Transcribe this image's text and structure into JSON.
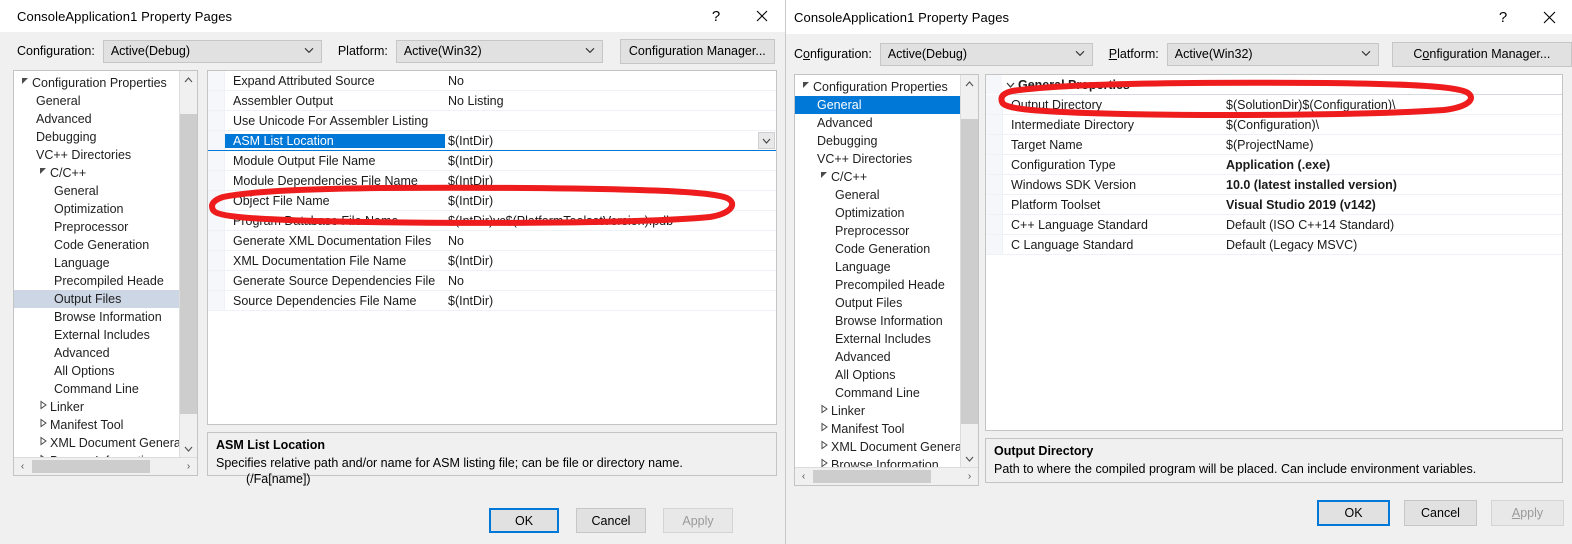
{
  "left_dialog": {
    "title": "ConsoleApplication1 Property Pages",
    "caption": {
      "help": "?",
      "close": "✕"
    },
    "config": {
      "configuration_label": "Configuration:",
      "configuration_value": "Active(Debug)",
      "platform_label": "Platform:",
      "platform_value": "Active(Win32)",
      "config_manager_button": "Configuration Manager..."
    },
    "tree": [
      {
        "label": "Configuration Properties",
        "indent": 0,
        "twisty": "expanded",
        "state": "normal"
      },
      {
        "label": "General",
        "indent": 1,
        "twisty": "none",
        "state": "normal"
      },
      {
        "label": "Advanced",
        "indent": 1,
        "twisty": "none",
        "state": "normal"
      },
      {
        "label": "Debugging",
        "indent": 1,
        "twisty": "none",
        "state": "normal"
      },
      {
        "label": "VC++ Directories",
        "indent": 1,
        "twisty": "none",
        "state": "normal"
      },
      {
        "label": "C/C++",
        "indent": 1,
        "twisty": "expanded",
        "state": "normal"
      },
      {
        "label": "General",
        "indent": 2,
        "twisty": "none",
        "state": "normal"
      },
      {
        "label": "Optimization",
        "indent": 2,
        "twisty": "none",
        "state": "normal"
      },
      {
        "label": "Preprocessor",
        "indent": 2,
        "twisty": "none",
        "state": "normal"
      },
      {
        "label": "Code Generation",
        "indent": 2,
        "twisty": "none",
        "state": "normal"
      },
      {
        "label": "Language",
        "indent": 2,
        "twisty": "none",
        "state": "normal"
      },
      {
        "label": "Precompiled Heade",
        "indent": 2,
        "twisty": "none",
        "state": "normal"
      },
      {
        "label": "Output Files",
        "indent": 2,
        "twisty": "none",
        "state": "selected"
      },
      {
        "label": "Browse Information",
        "indent": 2,
        "twisty": "none",
        "state": "normal"
      },
      {
        "label": "External Includes",
        "indent": 2,
        "twisty": "none",
        "state": "normal"
      },
      {
        "label": "Advanced",
        "indent": 2,
        "twisty": "none",
        "state": "normal"
      },
      {
        "label": "All Options",
        "indent": 2,
        "twisty": "none",
        "state": "normal"
      },
      {
        "label": "Command Line",
        "indent": 2,
        "twisty": "none",
        "state": "normal"
      },
      {
        "label": "Linker",
        "indent": 1,
        "twisty": "collapsed",
        "state": "normal"
      },
      {
        "label": "Manifest Tool",
        "indent": 1,
        "twisty": "collapsed",
        "state": "normal"
      },
      {
        "label": "XML Document Genera",
        "indent": 1,
        "twisty": "collapsed",
        "state": "normal"
      },
      {
        "label": "Browse Information",
        "indent": 1,
        "twisty": "collapsed",
        "state": "normal"
      }
    ],
    "grid": {
      "rows": [
        {
          "name": "Expand Attributed Source",
          "value": "No",
          "bold": false,
          "selected": false
        },
        {
          "name": "Assembler Output",
          "value": "No Listing",
          "bold": false,
          "selected": false
        },
        {
          "name": "Use Unicode For Assembler Listing",
          "value": "",
          "bold": false,
          "selected": false
        },
        {
          "name": "ASM List Location",
          "value": "$(IntDir)",
          "bold": false,
          "selected": true
        },
        {
          "name": "Module Output File Name",
          "value": "$(IntDir)",
          "bold": false,
          "selected": false
        },
        {
          "name": "Module Dependencies File Name",
          "value": "$(IntDir)",
          "bold": false,
          "selected": false
        },
        {
          "name": "Object File Name",
          "value": "$(IntDir)",
          "bold": false,
          "selected": false
        },
        {
          "name": "Program Database File Name",
          "value": "$(IntDir)vc$(PlatformToolsetVersion).pdb",
          "bold": false,
          "selected": false
        },
        {
          "name": "Generate XML Documentation Files",
          "value": "No",
          "bold": false,
          "selected": false
        },
        {
          "name": "XML Documentation File Name",
          "value": "$(IntDir)",
          "bold": false,
          "selected": false
        },
        {
          "name": "Generate Source Dependencies File",
          "value": "No",
          "bold": false,
          "selected": false
        },
        {
          "name": "Source Dependencies File Name",
          "value": "$(IntDir)",
          "bold": false,
          "selected": false
        }
      ]
    },
    "description": {
      "title": "ASM List Location",
      "body": "Specifies relative path and/or name for ASM listing file; can be file or directory name.",
      "switch": "(/Fa[name])"
    },
    "buttons": {
      "ok": "OK",
      "cancel": "Cancel",
      "apply": "Apply"
    }
  },
  "right_dialog": {
    "title": "ConsoleApplication1 Property Pages",
    "caption": {
      "help": "?",
      "close": "✕"
    },
    "config": {
      "configuration_label_pre": "C",
      "configuration_label_accel": "o",
      "configuration_label_post": "nfiguration:",
      "configuration_value": "Active(Debug)",
      "platform_label_pre": "",
      "platform_label_accel": "P",
      "platform_label_post": "latform:",
      "platform_value": "Active(Win32)",
      "cfgmgr_pre": "C",
      "cfgmgr_accel": "o",
      "cfgmgr_post": "nfiguration Manager..."
    },
    "tree": [
      {
        "label": "Configuration Properties",
        "indent": 0,
        "twisty": "expanded",
        "state": "normal"
      },
      {
        "label": "General",
        "indent": 1,
        "twisty": "none",
        "state": "selected-blue"
      },
      {
        "label": "Advanced",
        "indent": 1,
        "twisty": "none",
        "state": "normal"
      },
      {
        "label": "Debugging",
        "indent": 1,
        "twisty": "none",
        "state": "normal"
      },
      {
        "label": "VC++ Directories",
        "indent": 1,
        "twisty": "none",
        "state": "normal"
      },
      {
        "label": "C/C++",
        "indent": 1,
        "twisty": "expanded",
        "state": "normal"
      },
      {
        "label": "General",
        "indent": 2,
        "twisty": "none",
        "state": "normal"
      },
      {
        "label": "Optimization",
        "indent": 2,
        "twisty": "none",
        "state": "normal"
      },
      {
        "label": "Preprocessor",
        "indent": 2,
        "twisty": "none",
        "state": "normal"
      },
      {
        "label": "Code Generation",
        "indent": 2,
        "twisty": "none",
        "state": "normal"
      },
      {
        "label": "Language",
        "indent": 2,
        "twisty": "none",
        "state": "normal"
      },
      {
        "label": "Precompiled Heade",
        "indent": 2,
        "twisty": "none",
        "state": "normal"
      },
      {
        "label": "Output Files",
        "indent": 2,
        "twisty": "none",
        "state": "normal"
      },
      {
        "label": "Browse Information",
        "indent": 2,
        "twisty": "none",
        "state": "normal"
      },
      {
        "label": "External Includes",
        "indent": 2,
        "twisty": "none",
        "state": "normal"
      },
      {
        "label": "Advanced",
        "indent": 2,
        "twisty": "none",
        "state": "normal"
      },
      {
        "label": "All Options",
        "indent": 2,
        "twisty": "none",
        "state": "normal"
      },
      {
        "label": "Command Line",
        "indent": 2,
        "twisty": "none",
        "state": "normal"
      },
      {
        "label": "Linker",
        "indent": 1,
        "twisty": "collapsed",
        "state": "normal"
      },
      {
        "label": "Manifest Tool",
        "indent": 1,
        "twisty": "collapsed",
        "state": "normal"
      },
      {
        "label": "XML Document Genera",
        "indent": 1,
        "twisty": "collapsed",
        "state": "normal"
      },
      {
        "label": "Browse Information",
        "indent": 1,
        "twisty": "collapsed",
        "state": "normal"
      }
    ],
    "grid": {
      "group_header": "General Properties",
      "rows": [
        {
          "name": "Output Directory",
          "value": "$(SolutionDir)$(Configuration)\\",
          "bold": false
        },
        {
          "name": "Intermediate Directory",
          "value": "$(Configuration)\\",
          "bold": false
        },
        {
          "name": "Target Name",
          "value": "$(ProjectName)",
          "bold": false
        },
        {
          "name": "Configuration Type",
          "value": "Application (.exe)",
          "bold": true
        },
        {
          "name": "Windows SDK Version",
          "value": "10.0 (latest installed version)",
          "bold": true
        },
        {
          "name": "Platform Toolset",
          "value": "Visual Studio 2019 (v142)",
          "bold": true
        },
        {
          "name": "C++ Language Standard",
          "value": "Default (ISO C++14 Standard)",
          "bold": false
        },
        {
          "name": "C Language Standard",
          "value": "Default (Legacy MSVC)",
          "bold": false
        }
      ]
    },
    "description": {
      "title": "Output Directory",
      "body": "Path to where the compiled program will be placed. Can include environment variables."
    },
    "buttons": {
      "ok": "OK",
      "cancel": "Cancel",
      "apply_pre": "",
      "apply_accel": "A",
      "apply_post": "pply"
    }
  },
  "annotations": {
    "left_ellipse_target": "Object File Name",
    "right_ellipse_target": "Output Directory",
    "color": "#ee1c1c"
  }
}
